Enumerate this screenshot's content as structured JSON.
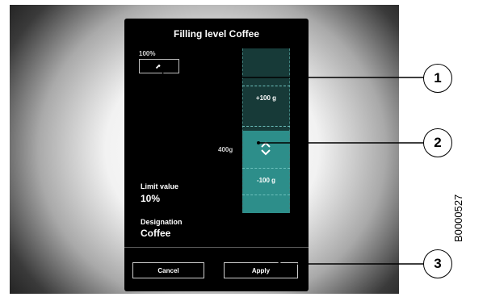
{
  "dialog": {
    "title": "Filling level Coffee",
    "max_percent_label": "100%",
    "increase_icon": "chevron-up-icon",
    "gauge": {
      "plus_label": "+100 g",
      "minus_label": "-100 g",
      "current_amount": "400g",
      "slider_icon": "up-down-chevron-icon",
      "fill_fraction": 0.5
    },
    "limit": {
      "label": "Limit value",
      "value": "10%"
    },
    "designation": {
      "label": "Designation",
      "value": "Coffee"
    },
    "buttons": {
      "cancel": "Cancel",
      "apply": "Apply"
    }
  },
  "callouts": [
    "1",
    "2",
    "3"
  ],
  "figure_code": "B0000527",
  "colors": {
    "screen_bg": "#000000",
    "gauge_fill": "#2d8e8a",
    "gauge_empty": "#173a38"
  }
}
